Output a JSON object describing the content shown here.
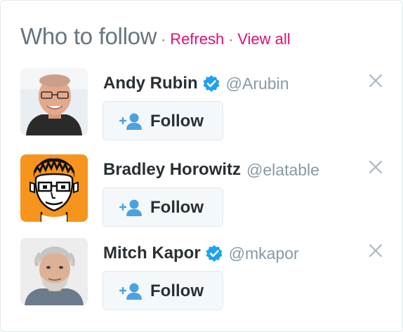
{
  "header": {
    "title": "Who to follow",
    "separator": "·",
    "refresh_label": "Refresh",
    "view_all_label": "View all"
  },
  "suggestions": [
    {
      "name": "Andy Rubin",
      "handle": "@Arubin",
      "verified": true,
      "follow_label": "Follow"
    },
    {
      "name": "Bradley Horowitz",
      "handle": "@elatable",
      "verified": false,
      "follow_label": "Follow"
    },
    {
      "name": "Mitch Kapor",
      "handle": "@mkapor",
      "verified": true,
      "follow_label": "Follow"
    }
  ],
  "colors": {
    "link": "#e0116f",
    "muted": "#66757f",
    "handle": "#8899a6",
    "verified": "#1da1f2",
    "follow_icon": "#4aa3df"
  },
  "icons": {
    "verified": "verified-badge-icon",
    "close": "close-icon",
    "follow": "add-user-icon"
  }
}
